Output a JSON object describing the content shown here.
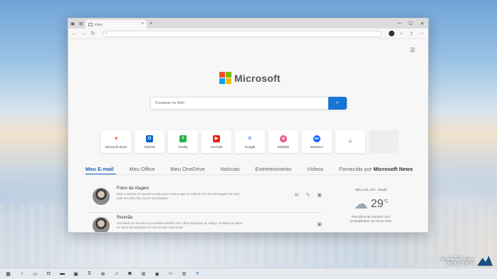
{
  "browser": {
    "tab_title": "Início",
    "url": "",
    "search_placeholder": "Pesquisar na Web"
  },
  "logo": {
    "text": "Microsoft",
    "colors": [
      "#f25022",
      "#7fba00",
      "#00a4ef",
      "#ffb900"
    ]
  },
  "tiles": [
    {
      "label": "Microsoft Store",
      "color": "#f3f3f3",
      "glyph": "■",
      "glyph_color": "#f25022"
    },
    {
      "label": "Outlook",
      "color": "#0a64c8",
      "glyph": "O",
      "glyph_color": "#ffffff"
    },
    {
      "label": "Feedly",
      "color": "#2bb24c",
      "glyph": "f",
      "glyph_color": "#ffffff"
    },
    {
      "label": "YouTube",
      "color": "#e62117",
      "glyph": "▶",
      "glyph_color": "#ffffff"
    },
    {
      "label": "Google",
      "color": "#ffffff",
      "glyph": "G",
      "glyph_color": "#4285f4"
    },
    {
      "label": "Dribbble",
      "color": "#ea4c89",
      "glyph": "◎",
      "glyph_color": "#ffffff"
    },
    {
      "label": "Behance",
      "color": "#1769ff",
      "glyph": "Bē",
      "glyph_color": "#ffffff"
    }
  ],
  "feed_tabs": [
    "Meu E-mail",
    "Meu Office",
    "Meu OneDrive",
    "Notícias",
    "Entretenimento",
    "Vídeos"
  ],
  "feed_tabs_tail": {
    "prefix": "Fornecido por",
    "brand": "Microsoft News"
  },
  "mail": [
    {
      "subject": "Fotos da Viagem",
      "preview": "Esse é apenas um pequeno teste para mostrar aqui no Outlook. Só uma mensagem de texto para ver como fica na pré-visualização."
    },
    {
      "subject": "Reunião",
      "preview": "Pensando se vai entrar na reunião amanhã com o time da equipe de design. Gostaria de saber se todos vão participar. É uma reunião importante."
    }
  ],
  "weather": {
    "location": "São Luís, MA · Brasil",
    "temp": "29",
    "unit": "°C",
    "desc": "Parcialmente nublado com probabilidade de chuva forte"
  },
  "watermark": {
    "ar": "موتاز للتكنولوجيا",
    "en": "MutazTech"
  }
}
